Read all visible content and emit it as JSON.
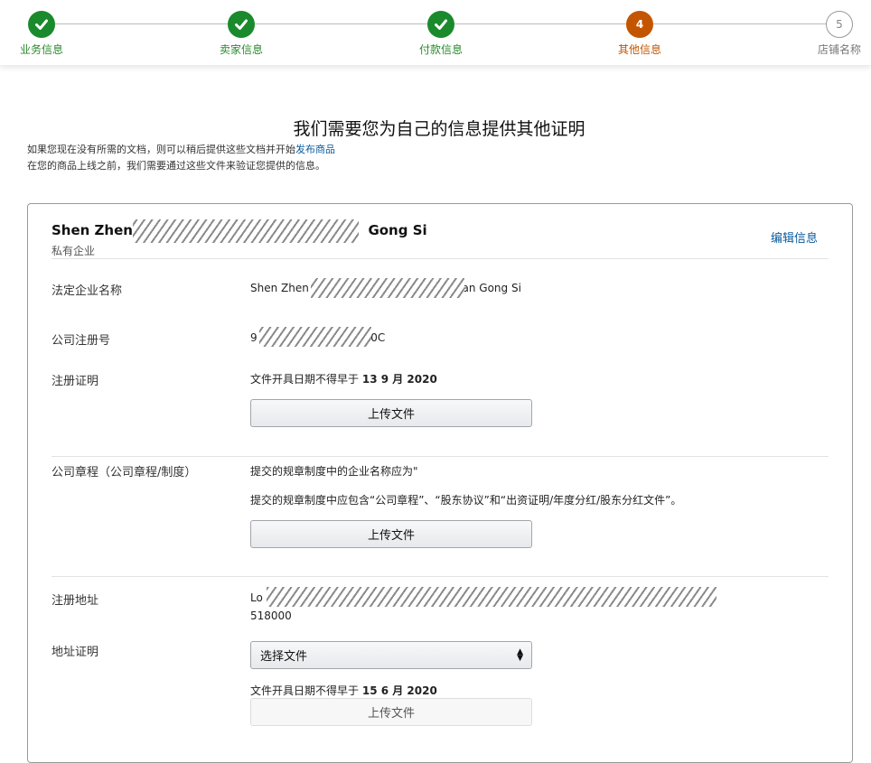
{
  "stepper": {
    "steps": [
      {
        "label": "业务信息",
        "state": "done"
      },
      {
        "label": "卖家信息",
        "state": "done"
      },
      {
        "label": "付款信息",
        "state": "done"
      },
      {
        "label": "其他信息",
        "state": "current",
        "number": "4"
      },
      {
        "label": "店铺名称",
        "state": "pending",
        "number": "5"
      }
    ],
    "colors": {
      "done": "#1a8a2c",
      "current": "#c45500",
      "pending": "#999999"
    }
  },
  "heading": "我们需要您为自己的信息提供其他证明",
  "intro": {
    "line1_prefix": "如果您现在没有所需的文档，则可以稍后提供这些文档并开始",
    "line1_link": "发布商品",
    "line2": "在您的商品上线之前，我们需要通过这些文件来验证您提供的信息。"
  },
  "card": {
    "company_name_start": "Shen Zhen",
    "company_name_end": "Gong Si",
    "company_type": "私有企业",
    "edit_link": "编辑信息",
    "rows": {
      "legal_name": {
        "label": "法定企业名称",
        "value_start": "Shen Zhen",
        "value_end": "an Gong Si"
      },
      "reg_number": {
        "label": "公司注册号",
        "value_start": "9",
        "value_end": "0C"
      },
      "reg_certificate": {
        "label": "注册证明",
        "date_text": "文件开具日期不得早于",
        "date_value": "13 9 月 2020",
        "upload": "上传文件"
      },
      "articles": {
        "label": "公司章程（公司章程/制度）",
        "line1": "提交的规章制度中的企业名称应为\"",
        "line2": "提交的规章制度中应包含“公司章程”、“股东协议”和“出资证明/年度分红/股东分红文件”。",
        "upload": "上传文件"
      },
      "reg_address": {
        "label": "注册地址",
        "value_start": "Lo",
        "postcode": "518000"
      },
      "address_proof": {
        "label": "地址证明",
        "select_value": "选择文件",
        "date_text": "文件开具日期不得早于",
        "date_value": "15 6 月 2020",
        "upload": "上传文件"
      }
    }
  }
}
